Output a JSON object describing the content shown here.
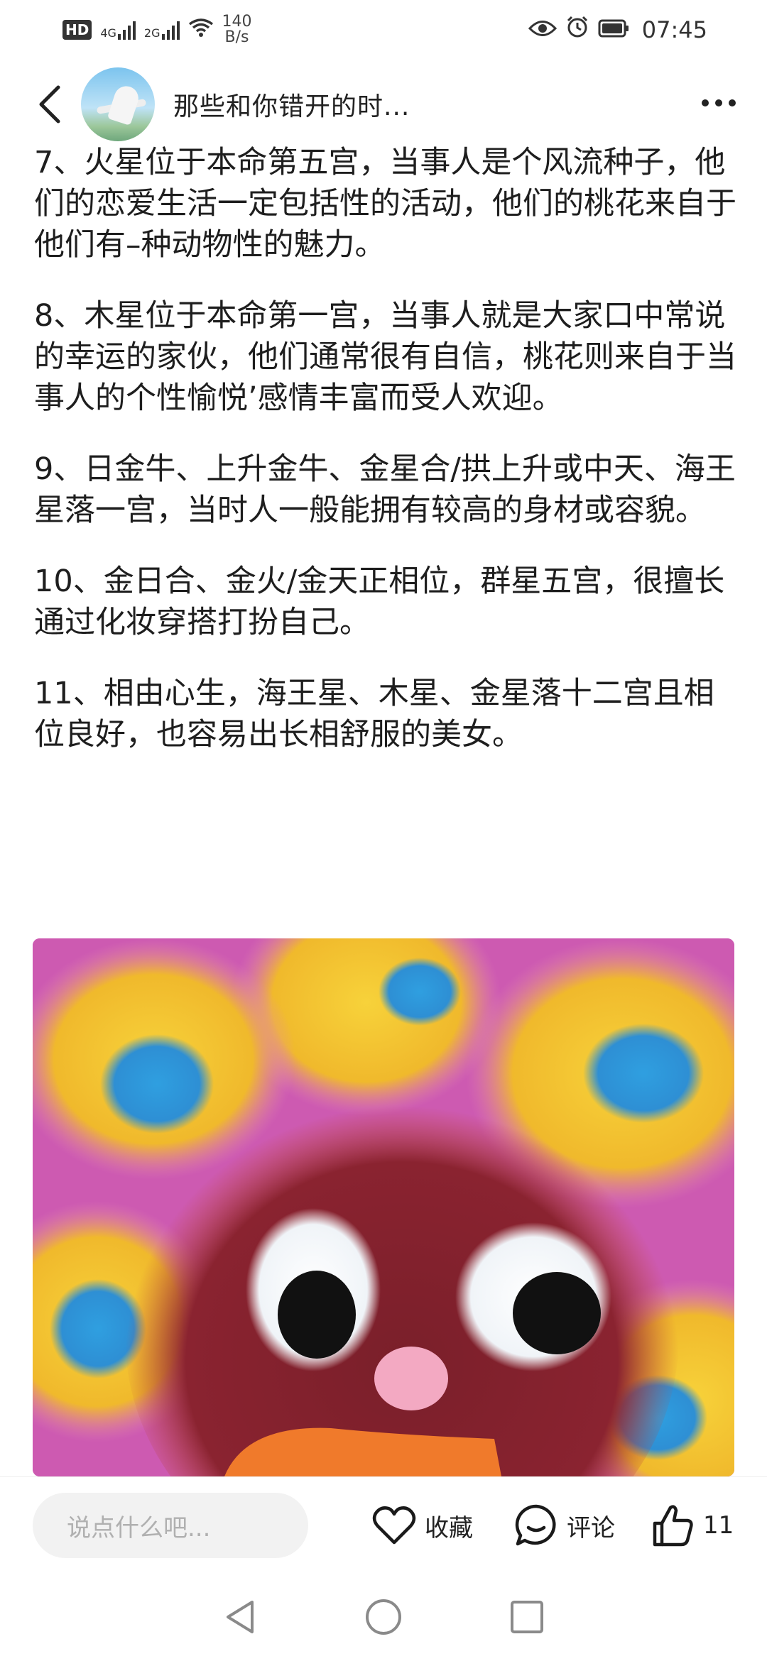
{
  "status_bar": {
    "network_speed_value": "140",
    "network_speed_unit": "B/s",
    "sim1_label": "4G",
    "sim2_label": "2G",
    "hd_label": "HD",
    "time": "07:45"
  },
  "header": {
    "title": "那些和你错开的时..."
  },
  "article": {
    "paragraphs": [
      "7、火星位于本命第五宫，当事人是个风流种子，他们的恋爱生活一定包括性的活动，他们的桃花来自于他们有–种动物性的魅力。",
      "8、木星位于本命第一宫，当事人就是大家口中常说的幸运的家伙，他们通常很有自信，桃花则来自于当事人的个性愉悦’感情丰富而受人欢迎。",
      "9、日金牛、上升金牛、金星合/拱上升或中天、海王星落一宫，当时人一般能拥有较高的身材或容貌。",
      "10、金日合、金火/金天正相位，群星五宫，很擅长通过化妆穿搭打扮自己。",
      "11、相由心生，海王星、木星、金星落十二宫且相位良好，也容易出长相舒服的美女。"
    ]
  },
  "bottom_bar": {
    "comment_placeholder": "说点什么吧...",
    "favorite_label": "收藏",
    "comment_label": "评论",
    "like_count": "11"
  },
  "icons": {
    "back": "back-arrow-icon",
    "more": "more-dots-icon",
    "favorite": "heart-icon",
    "comment": "chat-bubble-icon",
    "like": "thumbs-up-icon",
    "nav_back": "triangle-back-icon",
    "nav_home": "circle-home-icon",
    "nav_recents": "square-recents-icon"
  },
  "colors": {
    "image_bg": "#c84fb3",
    "petal_yellow": "#f2c230",
    "petal_spot": "#2f9fe0",
    "face": "#7a1f2a"
  }
}
